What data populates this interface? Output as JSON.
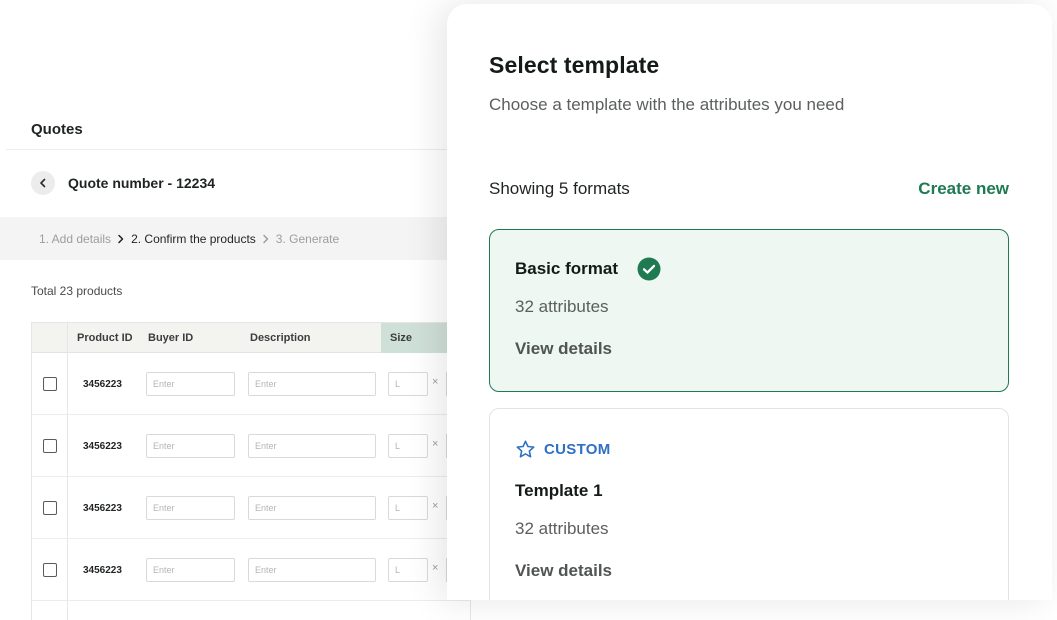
{
  "page": {
    "title": "Quotes",
    "quote_number": "Quote number - 12234",
    "steps": [
      {
        "label": "1. Add details",
        "state": "done"
      },
      {
        "label": "2. Confirm the products",
        "state": "active"
      },
      {
        "label": "3. Generate",
        "state": "upcoming"
      }
    ],
    "total_products": "Total 23 products"
  },
  "table": {
    "columns": {
      "product_id": "Product ID",
      "buyer_id": "Buyer ID",
      "description": "Description",
      "size": "Size"
    },
    "rows": [
      {
        "product_id": "3456223",
        "buyer_placeholder": "Enter",
        "desc_placeholder": "Enter",
        "size_placeholder": "L",
        "clear": "×"
      },
      {
        "product_id": "3456223",
        "buyer_placeholder": "Enter",
        "desc_placeholder": "Enter",
        "size_placeholder": "L",
        "clear": "×"
      },
      {
        "product_id": "3456223",
        "buyer_placeholder": "Enter",
        "desc_placeholder": "Enter",
        "size_placeholder": "L",
        "clear": "×"
      },
      {
        "product_id": "3456223",
        "buyer_placeholder": "Enter",
        "desc_placeholder": "Enter",
        "size_placeholder": "L",
        "clear": "×"
      }
    ]
  },
  "modal": {
    "title": "Select template",
    "subtitle": "Choose a template with the attributes you need",
    "showing": "Showing 5 formats",
    "create_new": "Create new",
    "templates": [
      {
        "name": "Basic format",
        "attributes": "32 attributes",
        "link": "View details",
        "selected": true
      },
      {
        "tag": "CUSTOM",
        "name": "Template 1",
        "attributes": "32 attributes",
        "link": "View details",
        "selected": false
      }
    ]
  },
  "colors": {
    "accent_green": "#1f7a52",
    "selected_card_bg": "#eef7f2",
    "custom_blue": "#2f6fc4"
  },
  "icons": [
    "chevron-left-icon",
    "chevron-right-icon",
    "check-circle-icon",
    "star-outline-icon"
  ]
}
